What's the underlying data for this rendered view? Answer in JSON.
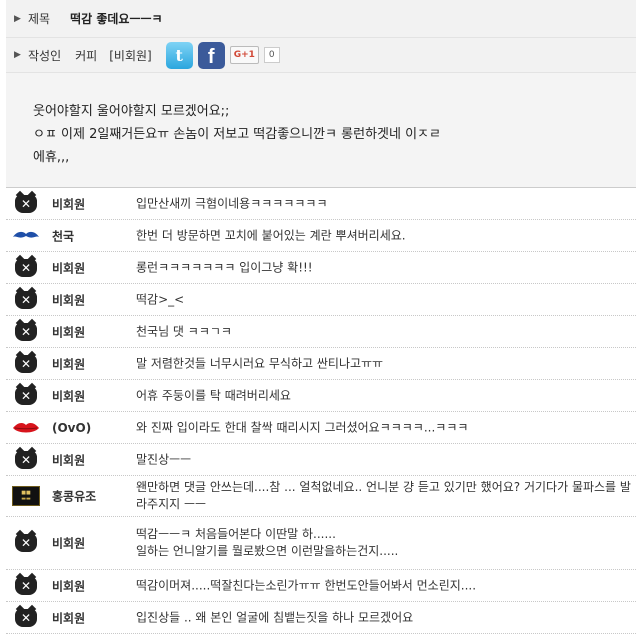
{
  "header": {
    "title_label": "제목",
    "title": "떡감 좋데요ㅡㅡㅋ",
    "author_label": "작성인",
    "author_name": "커피",
    "author_level": "[비회원]",
    "gplus_label": "G+1",
    "gplus_count": "0"
  },
  "post": {
    "lines": [
      "웃어야할지 울어야할지 모르겠어요;;",
      "ㅇㅍ 이제 2일째거든요ㅠ  손놈이 저보고 떡감좋으니깐ㅋ 롱런하겟네 이ㅈㄹ",
      "에휴,,,"
    ]
  },
  "comments": [
    {
      "icon": "x-face-icon",
      "name": "비회원",
      "text": "입만산새끼 극혐이네용ㅋㅋㅋㅋㅋㅋㅋ"
    },
    {
      "icon": "mustache-icon",
      "name": "천국",
      "text": "한번 더 방문하면 꼬치에 붙어있는 계란 뿌셔버리세요."
    },
    {
      "icon": "x-face-icon",
      "name": "비회원",
      "text": "롱런ㅋㅋㅋㅋㅋㅋㅋ 입이그냥 확!!!"
    },
    {
      "icon": "x-face-icon",
      "name": "비회원",
      "text": "떡감>_<"
    },
    {
      "icon": "x-face-icon",
      "name": "비회원",
      "text": "천국님 댓 ㅋㅋㄱㅋ"
    },
    {
      "icon": "x-face-icon",
      "name": "비회원",
      "text": "말 저렴한것들 너무시러요 무식하고 싼티나고ㅠㅠ"
    },
    {
      "icon": "x-face-icon",
      "name": "비회원",
      "text": "어휴 주둥이를 탁 때려버리세요"
    },
    {
      "icon": "lips-icon",
      "name": "(OvO)",
      "text": "와 진짜 입이라도 한대 찰싹 때리시지 그러셨어요ㅋㅋㅋㅋ...ㅋㅋㅋ"
    },
    {
      "icon": "x-face-icon",
      "name": "비회원",
      "text": "말진상ㅡㅡ"
    },
    {
      "icon": "brand-icon",
      "name": "홍콩유조",
      "text": "왠만하면 댓글 안쓰는데....참 ... 얼척없네요.. 언니분 걍 듣고 있기만 했어요? 거기다가 물파스를 발라주지지 ㅡㅡ"
    },
    {
      "icon": "x-face-icon",
      "name": "비회원",
      "text": "떡감ㅡㅡㅋ 처음들어본다 이딴말 하......\n일하는 언니알기를 뭘로봤으면 이런말을하는건지....."
    },
    {
      "icon": "x-face-icon",
      "name": "비회원",
      "text": "떡감이머져.....떡잘친다는소린가ㅠㅠ 한번도안들어봐서 먼소린지...."
    },
    {
      "icon": "x-face-icon",
      "name": "비회원",
      "text": "입진상들 .. 왜 본인 얼굴에 침뱉는짓을 하나 모르겠어요"
    }
  ]
}
